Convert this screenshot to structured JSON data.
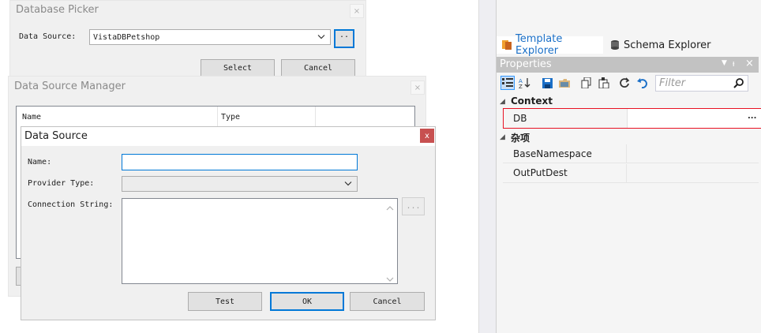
{
  "db_picker": {
    "title": "Database Picker",
    "datasource_label": "Data Source:",
    "datasource_value": "VistaDBPetshop",
    "browse_label": "..",
    "select_label": "Select",
    "cancel_label": "Cancel"
  },
  "ds_manager": {
    "title": "Data Source Manager",
    "columns": [
      "Name",
      "Type"
    ]
  },
  "ds_dialog": {
    "title": "Data Source",
    "close_label": "x",
    "name_label": "Name:",
    "name_value": "",
    "provider_label": "Provider Type:",
    "provider_value": "",
    "connection_label": "Connection String:",
    "connection_value": "",
    "ellipsis_label": "...",
    "test_label": "Test",
    "ok_label": "OK",
    "cancel_label": "Cancel"
  },
  "explorer_tabs": {
    "template": "Template Explorer",
    "schema": "Schema Explorer"
  },
  "properties": {
    "title": "Properties",
    "filter_placeholder": "Filter",
    "categories": [
      {
        "name": "Context",
        "props": [
          {
            "name": "DB",
            "value": "",
            "button": "..."
          }
        ]
      },
      {
        "name": "杂项",
        "props": [
          {
            "name": "BaseNamespace",
            "value": ""
          },
          {
            "name": "OutPutDest",
            "value": ""
          }
        ]
      }
    ]
  },
  "colors": {
    "accent": "#0078d7",
    "close_red": "#c75050",
    "selection_border": "#e81123",
    "panel_header": "#c2c2c2"
  }
}
